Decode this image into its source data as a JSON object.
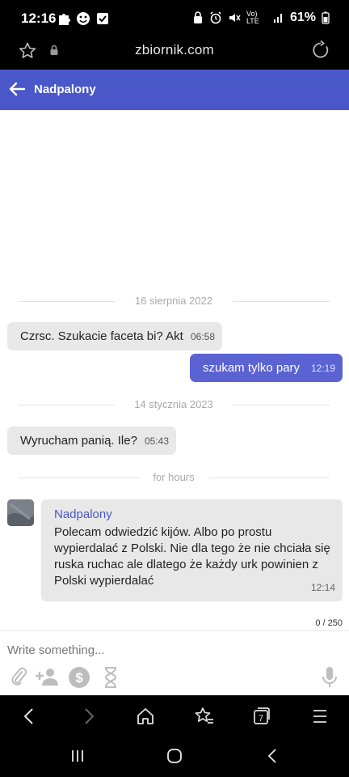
{
  "status_bar": {
    "time": "12:16",
    "signal_text": "Vo) LTE",
    "battery_percent": "61%"
  },
  "browser": {
    "url": "zbiornik.com"
  },
  "header": {
    "title": "Nadpalony"
  },
  "chat": {
    "date_separators": [
      "16 sierpnia 2022",
      "14 stycznia 2023",
      "for hours"
    ],
    "messages": [
      {
        "direction": "in",
        "text": "Czrsc. Szukacie faceta bi? Akt",
        "time": "06:58"
      },
      {
        "direction": "out",
        "text": "szukam tylko pary",
        "time": "12:19"
      },
      {
        "direction": "in",
        "text": "Wyrucham panią. Ile?",
        "time": "05:43"
      }
    ],
    "last_message": {
      "sender": "Nadpalony",
      "text": "Polecam odwiedzić kijów. Albo po prostu wypierdalać z Polski. Nie dla tego że nie chciała się ruska ruchac ale dlatego że każdy urk powinien z Polski wypierdalać",
      "time": "12:14"
    }
  },
  "composer": {
    "char_counter": "0 / 250",
    "placeholder": "Write something..."
  },
  "colors": {
    "header": "#4a57c9",
    "outgoing_bubble": "#5b63d3",
    "incoming_bubble": "#e8e8e8",
    "sender_name": "#4a57c9"
  }
}
